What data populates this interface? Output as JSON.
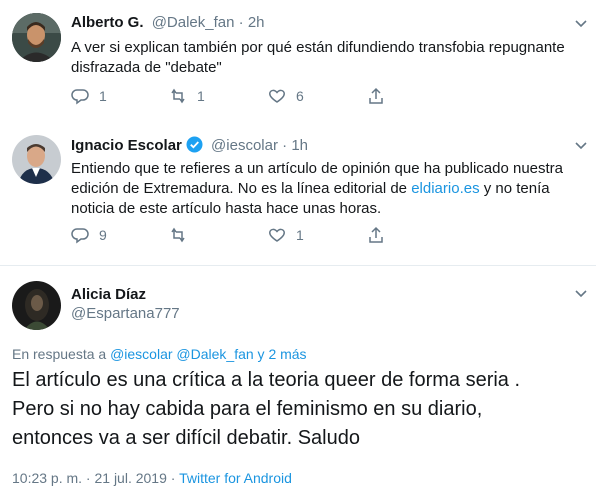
{
  "tweet1": {
    "name": "Alberto G.",
    "handle": "@Dalek_fan",
    "dot": "·",
    "time": "2h",
    "text_lines": [
      "A ver si explican también por qué están difundiendo transfobia repugnante",
      "disfrazada de \"debate\""
    ],
    "reply_count": "1",
    "retweet_count": "1",
    "like_count": "6"
  },
  "tweet2": {
    "name": "Ignacio Escolar",
    "handle": "@iescolar",
    "dot": "·",
    "time": "1h",
    "line1": "Entiendo que te refieres a un artículo de opinión que ha publicado nuestra",
    "line2_pre": "edición de Extremadura. No es la línea editorial de ",
    "line2_link": "eldiario.es",
    "line2_post": " y no tenía",
    "line3": "noticia  de este artículo hasta hace unas horas.",
    "reply_count": "9",
    "like_count": "1"
  },
  "tweet3": {
    "name": "Alicia Díaz",
    "handle": "@Espartana777",
    "reply_prefix": "En respuesta a",
    "reply_to": "@iescolar @Dalek_fan y 2 más",
    "text_lines": [
      "El artículo es una crítica a la teoria queer  de forma seria .",
      "Pero si no hay cabida para el feminismo en su diario,",
      "entonces va a ser difícil debatir.  Saludo"
    ],
    "timestamp": "10:23 p. m. · 21 jul. 2019 · ",
    "source": "Twitter for Android"
  },
  "colors": {
    "link": "#1b95e0",
    "muted": "#657786",
    "text": "#14171a",
    "verified": "#1da1f2"
  },
  "icons": [
    "reply-icon",
    "retweet-icon",
    "like-icon",
    "share-icon",
    "chevron-down-icon",
    "verified-badge-icon"
  ]
}
